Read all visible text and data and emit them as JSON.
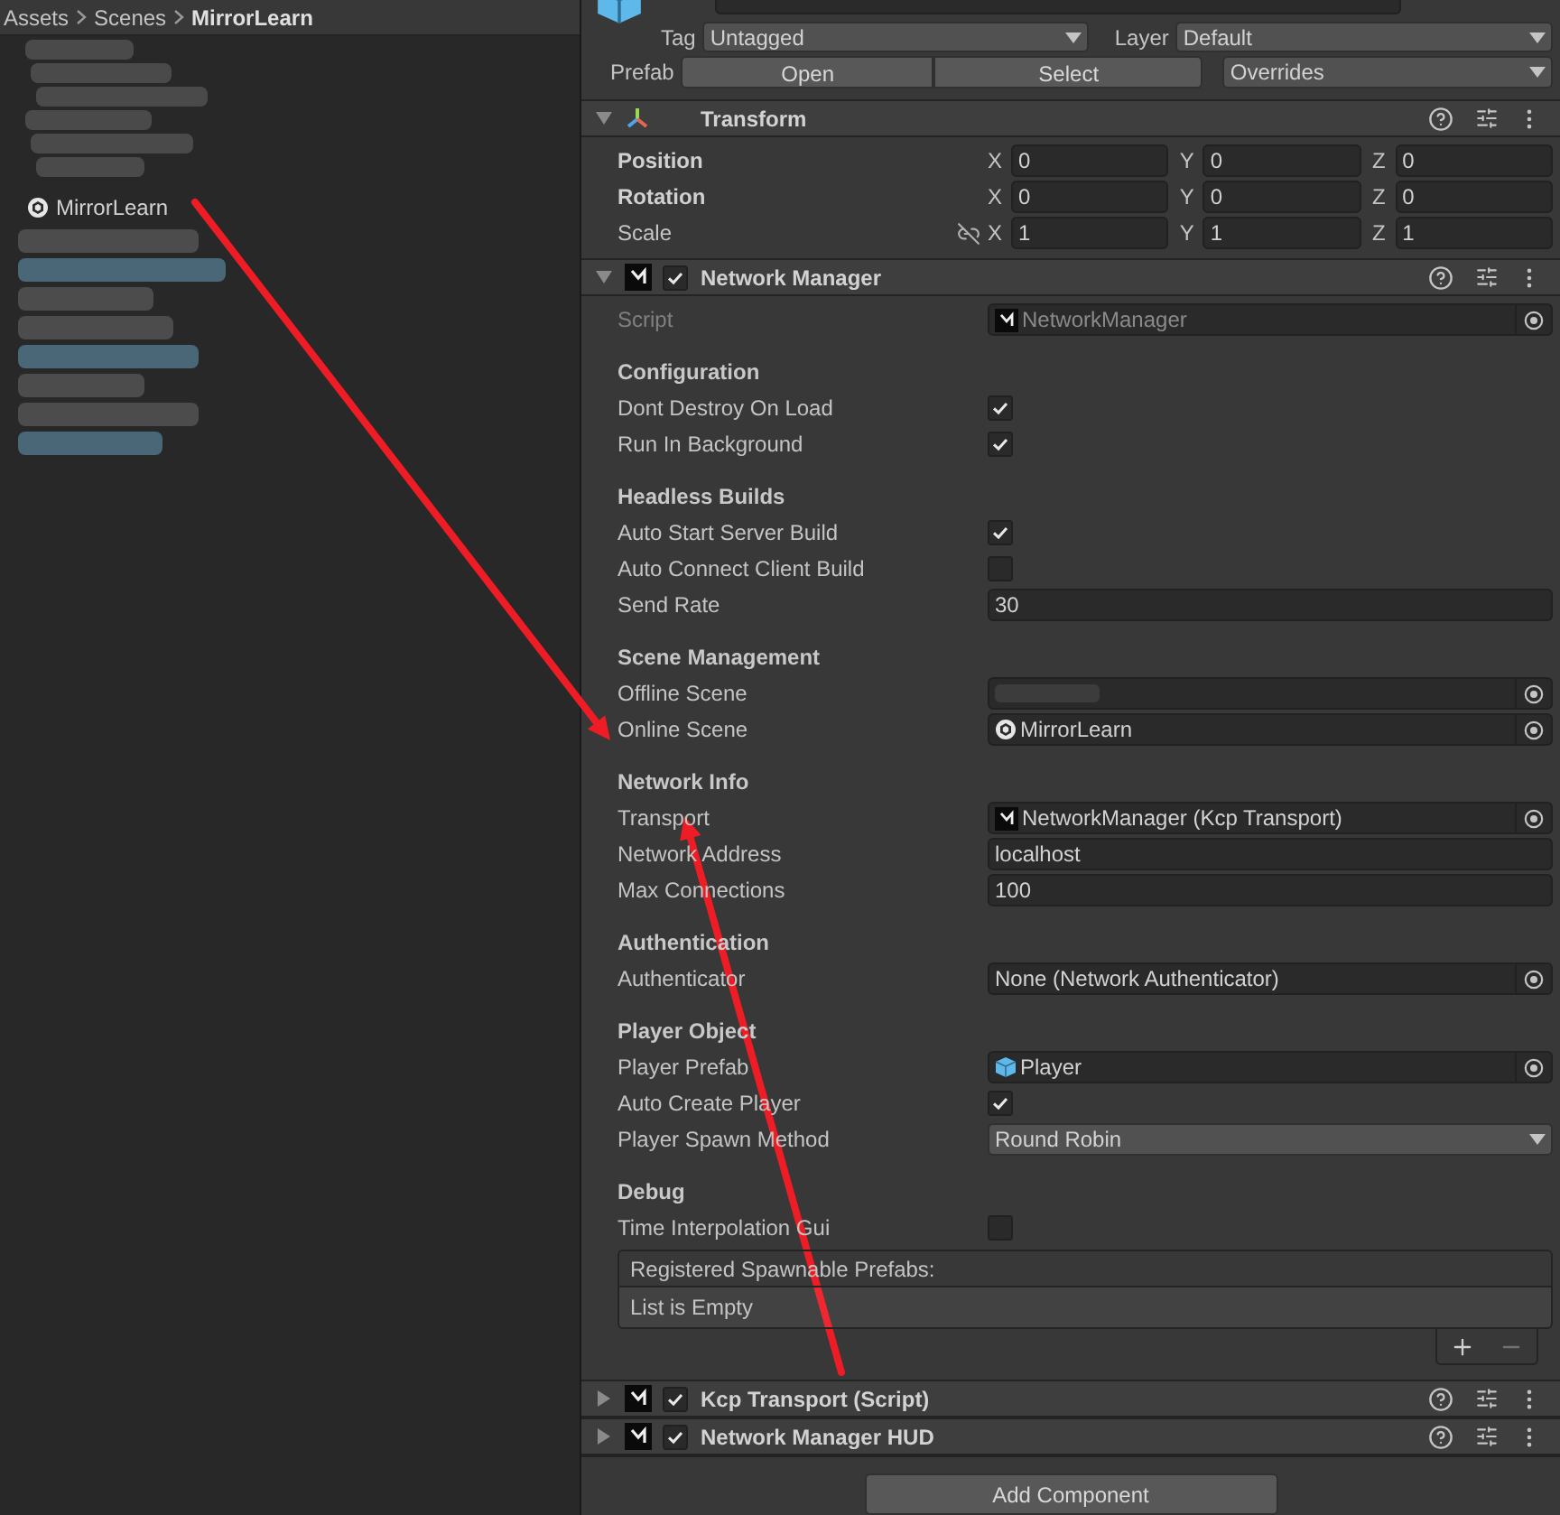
{
  "breadcrumb": [
    "Assets",
    "Scenes",
    "MirrorLearn"
  ],
  "hierarchy": {
    "item": {
      "label": "MirrorLearn"
    }
  },
  "header": {
    "tag": {
      "label": "Tag",
      "value": "Untagged"
    },
    "layer": {
      "label": "Layer",
      "value": "Default"
    },
    "prefab": {
      "label": "Prefab",
      "buttons": [
        "Open",
        "Select"
      ],
      "overrides": "Overrides"
    }
  },
  "components": [
    {
      "title": "Transform",
      "kind": "transform",
      "expanded": true,
      "rows": [
        {
          "label": "Position",
          "bold": true,
          "values": [
            {
              "axis": "X",
              "value": "0"
            },
            {
              "axis": "Y",
              "value": "0"
            },
            {
              "axis": "Z",
              "value": "0"
            }
          ]
        },
        {
          "label": "Rotation",
          "bold": true,
          "values": [
            {
              "axis": "X",
              "value": "0"
            },
            {
              "axis": "Y",
              "value": "0"
            },
            {
              "axis": "Z",
              "value": "0"
            }
          ]
        },
        {
          "label": "Scale",
          "bold": false,
          "linked": false,
          "values": [
            {
              "axis": "X",
              "value": "1"
            },
            {
              "axis": "Y",
              "value": "1"
            },
            {
              "axis": "Z",
              "value": "1"
            }
          ]
        }
      ]
    },
    {
      "title": "Network Manager",
      "kind": "script",
      "enabled": true,
      "expanded": true,
      "fields": [
        {
          "kind": "scriptref",
          "label": "Script",
          "value": "NetworkManager",
          "disabled": true
        },
        {
          "kind": "header",
          "label": "Configuration"
        },
        {
          "kind": "checkbox",
          "label": "Dont Destroy On Load",
          "checked": true
        },
        {
          "kind": "checkbox",
          "label": "Run In Background",
          "checked": true
        },
        {
          "kind": "header",
          "label": "Headless Builds"
        },
        {
          "kind": "checkbox",
          "label": "Auto Start Server Build",
          "checked": true
        },
        {
          "kind": "checkbox",
          "label": "Auto Connect Client Build",
          "checked": false
        },
        {
          "kind": "text",
          "label": "Send Rate",
          "value": "30"
        },
        {
          "kind": "header",
          "label": "Scene Management"
        },
        {
          "kind": "object",
          "label": "Offline Scene"
        },
        {
          "kind": "sceneref",
          "label": "Online Scene",
          "value": "MirrorLearn"
        },
        {
          "kind": "header",
          "label": "Network Info"
        },
        {
          "kind": "scriptref",
          "label": "Transport",
          "value": "NetworkManager (Kcp Transport)"
        },
        {
          "kind": "text",
          "label": "Network Address",
          "value": "localhost"
        },
        {
          "kind": "text",
          "label": "Max Connections",
          "value": "100"
        },
        {
          "kind": "header",
          "label": "Authentication"
        },
        {
          "kind": "object",
          "label": "Authenticator",
          "value": "None (Network Authenticator)"
        },
        {
          "kind": "header",
          "label": "Player Object"
        },
        {
          "kind": "prefabref",
          "label": "Player Prefab",
          "value": "Player"
        },
        {
          "kind": "checkbox",
          "label": "Auto Create Player",
          "checked": true
        },
        {
          "kind": "dropdown",
          "label": "Player Spawn Method",
          "value": "Round Robin"
        },
        {
          "kind": "header",
          "label": "Debug"
        },
        {
          "kind": "checkbox",
          "label": "Time Interpolation Gui",
          "checked": false
        },
        {
          "kind": "list",
          "title": "Registered Spawnable Prefabs:",
          "empty": "List is Empty"
        }
      ]
    },
    {
      "title": "Kcp Transport (Script)",
      "kind": "script",
      "enabled": true,
      "expanded": false
    },
    {
      "title": "Network Manager HUD",
      "kind": "script",
      "enabled": true,
      "expanded": false
    }
  ],
  "add_component": "Add Component"
}
